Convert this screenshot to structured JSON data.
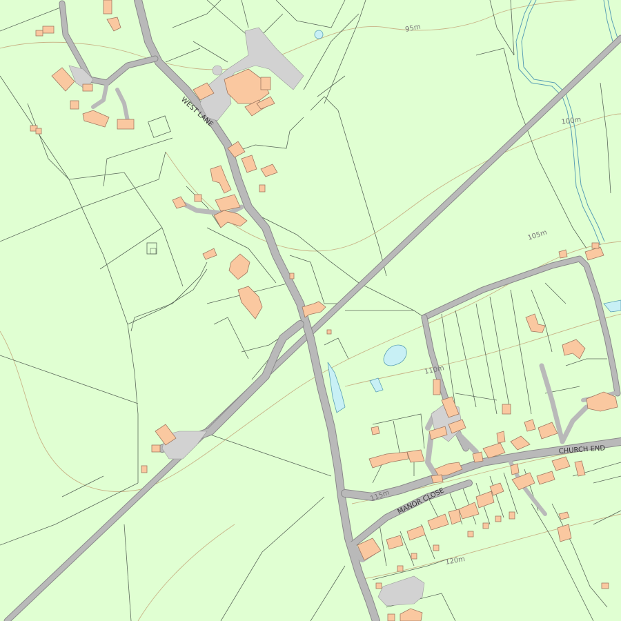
{
  "map": {
    "road_labels": {
      "west_lane": "WEST LANE",
      "church_end": "CHURCH END",
      "manor_close": "MANOR CLOSE"
    },
    "contour_labels": {
      "c95": "95m",
      "c100": "100m",
      "c105": "105m",
      "c110": "110m",
      "c115": "115m",
      "c120": "120m"
    },
    "colors": {
      "land": "#e0ffd2",
      "building": "#fac8a0",
      "road": "#b9b9b9",
      "water": "#c8f0f5",
      "contour": "#c8b487",
      "field_boundary": "#5a6a5a"
    }
  }
}
